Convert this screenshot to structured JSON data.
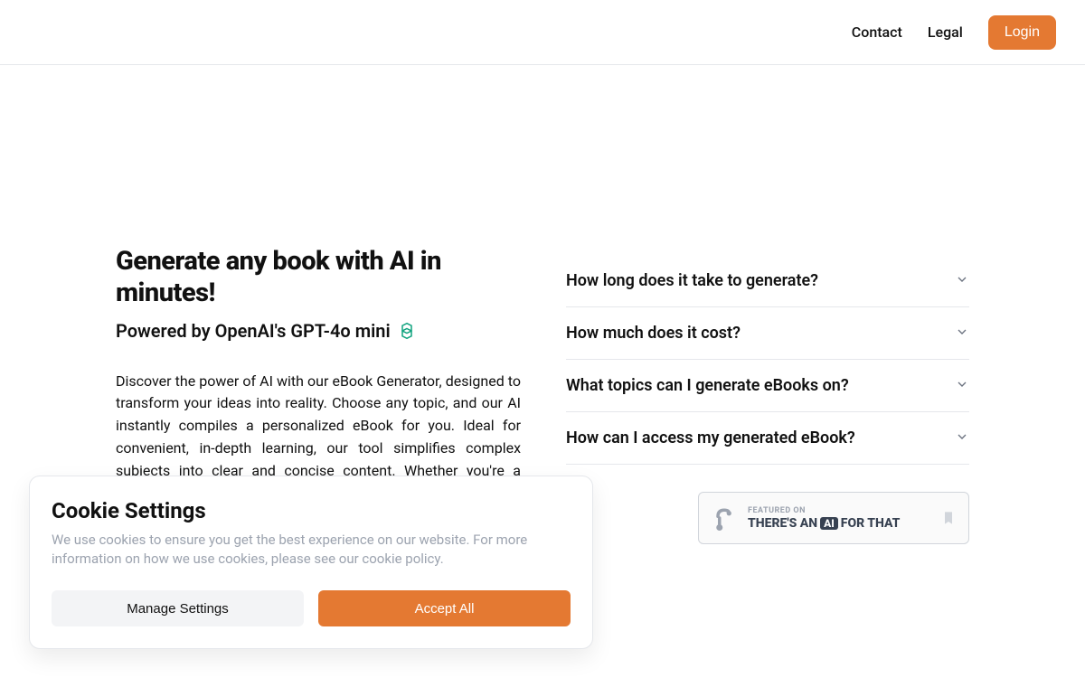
{
  "nav": {
    "contact": "Contact",
    "legal": "Legal",
    "login": "Login"
  },
  "hero": {
    "headline": "Generate any book with AI in minutes!",
    "subhead": "Powered by OpenAI's GPT-4o mini",
    "body": "Discover the power of AI with our eBook Generator, designed to transform your ideas into reality. Choose any topic, and our AI instantly compiles a personalized eBook for you. Ideal for convenient, in-depth learning, our tool simplifies complex subjects into clear and concise content. Whether you're a student, professional, or just curious, our eBook Generator is the perfect tool for you."
  },
  "faq": {
    "items": [
      {
        "q": "How long does it take to generate?"
      },
      {
        "q": "How much does it cost?"
      },
      {
        "q": "What topics can I generate eBooks on?"
      },
      {
        "q": "How can I access my generated eBook?"
      }
    ]
  },
  "featured": {
    "top": "FEATURED ON",
    "prefix": "THERE'S AN",
    "ai": "AI",
    "suffix": "FOR THAT"
  },
  "cookie": {
    "title": "Cookie Settings",
    "desc": "We use cookies to ensure you get the best experience on our website. For more information on how we use cookies, please see our cookie policy.",
    "manage": "Manage Settings",
    "accept": "Accept All"
  }
}
